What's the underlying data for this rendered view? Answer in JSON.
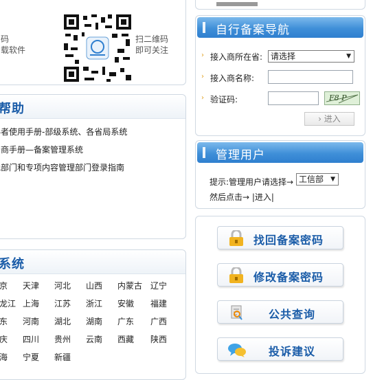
{
  "qr_panel": {
    "left_text": [
      "码",
      "载软件"
    ],
    "right_text": [
      "扫二维码",
      "即可关注"
    ]
  },
  "help_panel": {
    "title": "统帮助",
    "links": [
      "办者使用手册-部级系统、各省局系统",
      "务商手册—备案管理系统",
      "批部门和专项内容管理部门登录指南"
    ]
  },
  "bureau_panel": {
    "title": "局系统",
    "provinces": [
      [
        "北京",
        "天津",
        "河北",
        "山西",
        "内蒙古",
        "辽宁"
      ],
      [
        "黑龙江",
        "上海",
        "江苏",
        "浙江",
        "安徽",
        "福建"
      ],
      [
        "山东",
        "河南",
        "湖北",
        "湖南",
        "广东",
        "广西"
      ],
      [
        "重庆",
        "四川",
        "贵州",
        "云南",
        "西藏",
        "陕西"
      ],
      [
        "青海",
        "宁夏",
        "新疆"
      ]
    ]
  },
  "nav_panel": {
    "title": "自行备案导航",
    "province_label": "接入商所在省:",
    "province_select": "请选择",
    "name_label": "接入商名称:",
    "captcha_label": "验证码:",
    "captcha_text": "F8 P",
    "enter_label": "进入"
  },
  "admin_panel": {
    "title": "管理用户",
    "hint_prefix": "提示:管理用户请选择→",
    "dept_select": "工信部",
    "hint_suffix": "然后点击→ |进入|"
  },
  "tools_panel": {
    "buttons": [
      {
        "label": "找回备案密码",
        "icon": "lock-icon"
      },
      {
        "label": "修改备案密码",
        "icon": "lock-icon"
      },
      {
        "label": "公共查询",
        "icon": "search-doc-icon"
      },
      {
        "label": "投诉建议",
        "icon": "chat-icon"
      }
    ]
  }
}
